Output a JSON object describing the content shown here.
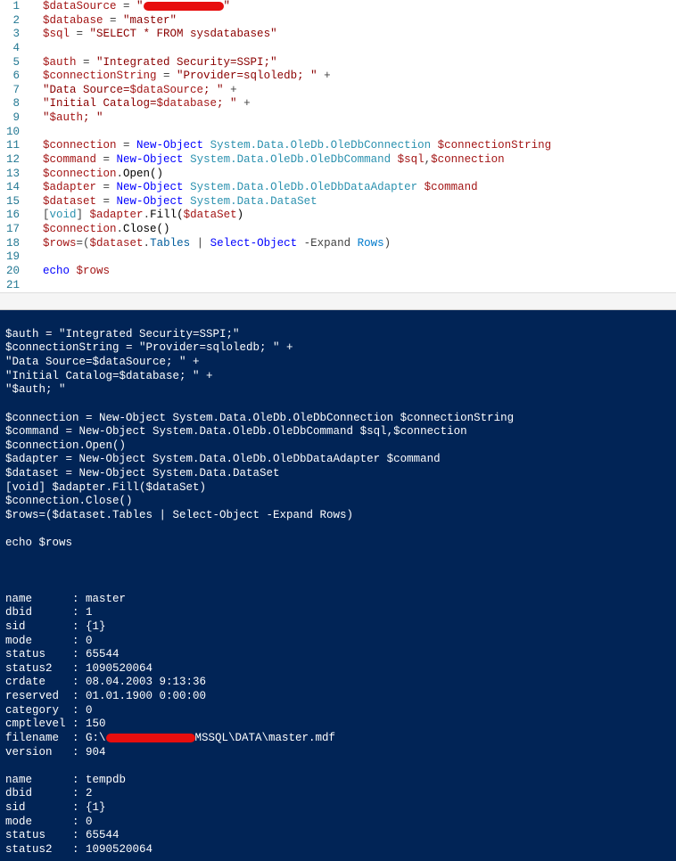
{
  "editor": {
    "lines": [
      {
        "n": 1,
        "tokens": [
          {
            "t": "$dataSource",
            "c": "tok-var"
          },
          {
            "t": " = ",
            "c": "tok-op"
          },
          {
            "t": "\"",
            "c": "tok-str"
          },
          {
            "redact": 90
          },
          {
            "t": "\"",
            "c": "tok-str"
          }
        ]
      },
      {
        "n": 2,
        "tokens": [
          {
            "t": "$database",
            "c": "tok-var"
          },
          {
            "t": " = ",
            "c": "tok-op"
          },
          {
            "t": "\"master\"",
            "c": "tok-str"
          }
        ]
      },
      {
        "n": 3,
        "tokens": [
          {
            "t": "$sql",
            "c": "tok-var"
          },
          {
            "t": " = ",
            "c": "tok-op"
          },
          {
            "t": "\"SELECT * FROM sysdatabases\"",
            "c": "tok-str"
          }
        ]
      },
      {
        "n": 4,
        "tokens": []
      },
      {
        "n": 5,
        "tokens": [
          {
            "t": "$auth",
            "c": "tok-var"
          },
          {
            "t": " = ",
            "c": "tok-op"
          },
          {
            "t": "\"Integrated Security=SSPI;\"",
            "c": "tok-str"
          }
        ]
      },
      {
        "n": 6,
        "tokens": [
          {
            "t": "$connectionString",
            "c": "tok-var"
          },
          {
            "t": " = ",
            "c": "tok-op"
          },
          {
            "t": "\"Provider=sqloledb; \"",
            "c": "tok-str"
          },
          {
            "t": " + ",
            "c": "tok-op"
          }
        ]
      },
      {
        "n": 7,
        "tokens": [
          {
            "t": "\"Data Source=",
            "c": "tok-str"
          },
          {
            "t": "$dataSource",
            "c": "tok-var"
          },
          {
            "t": "; \"",
            "c": "tok-str"
          },
          {
            "t": " + ",
            "c": "tok-op"
          }
        ]
      },
      {
        "n": 8,
        "tokens": [
          {
            "t": "\"Initial Catalog=",
            "c": "tok-str"
          },
          {
            "t": "$database",
            "c": "tok-var"
          },
          {
            "t": "; \"",
            "c": "tok-str"
          },
          {
            "t": " + ",
            "c": "tok-op"
          }
        ]
      },
      {
        "n": 9,
        "tokens": [
          {
            "t": "\"",
            "c": "tok-str"
          },
          {
            "t": "$auth",
            "c": "tok-var"
          },
          {
            "t": "; \"",
            "c": "tok-str"
          }
        ]
      },
      {
        "n": 10,
        "tokens": []
      },
      {
        "n": 11,
        "tokens": [
          {
            "t": "$connection",
            "c": "tok-var"
          },
          {
            "t": " = ",
            "c": "tok-op"
          },
          {
            "t": "New-Object",
            "c": "tok-kw"
          },
          {
            "t": " ",
            "c": ""
          },
          {
            "t": "System.Data.OleDb.OleDbConnection",
            "c": "tok-type"
          },
          {
            "t": " ",
            "c": ""
          },
          {
            "t": "$connectionString",
            "c": "tok-var"
          }
        ]
      },
      {
        "n": 12,
        "tokens": [
          {
            "t": "$command",
            "c": "tok-var"
          },
          {
            "t": " = ",
            "c": "tok-op"
          },
          {
            "t": "New-Object",
            "c": "tok-kw"
          },
          {
            "t": " ",
            "c": ""
          },
          {
            "t": "System.Data.OleDb.OleDbCommand",
            "c": "tok-type"
          },
          {
            "t": " ",
            "c": ""
          },
          {
            "t": "$sql",
            "c": "tok-var"
          },
          {
            "t": ",",
            "c": "tok-op"
          },
          {
            "t": "$connection",
            "c": "tok-var"
          }
        ]
      },
      {
        "n": 13,
        "tokens": [
          {
            "t": "$connection",
            "c": "tok-var"
          },
          {
            "t": ".",
            "c": "tok-op"
          },
          {
            "t": "Open()",
            "c": "tok-method"
          }
        ]
      },
      {
        "n": 14,
        "tokens": [
          {
            "t": "$adapter",
            "c": "tok-var"
          },
          {
            "t": " = ",
            "c": "tok-op"
          },
          {
            "t": "New-Object",
            "c": "tok-kw"
          },
          {
            "t": " ",
            "c": ""
          },
          {
            "t": "System.Data.OleDb.OleDbDataAdapter",
            "c": "tok-type"
          },
          {
            "t": " ",
            "c": ""
          },
          {
            "t": "$command",
            "c": "tok-var"
          }
        ]
      },
      {
        "n": 15,
        "tokens": [
          {
            "t": "$dataset",
            "c": "tok-var"
          },
          {
            "t": " = ",
            "c": "tok-op"
          },
          {
            "t": "New-Object",
            "c": "tok-kw"
          },
          {
            "t": " ",
            "c": ""
          },
          {
            "t": "System.Data.DataSet",
            "c": "tok-type"
          }
        ]
      },
      {
        "n": 16,
        "tokens": [
          {
            "t": "[",
            "c": "tok-op"
          },
          {
            "t": "void",
            "c": "tok-type"
          },
          {
            "t": "] ",
            "c": "tok-op"
          },
          {
            "t": "$adapter",
            "c": "tok-var"
          },
          {
            "t": ".",
            "c": "tok-op"
          },
          {
            "t": "Fill(",
            "c": "tok-method"
          },
          {
            "t": "$dataSet",
            "c": "tok-var"
          },
          {
            "t": ")",
            "c": "tok-method"
          }
        ]
      },
      {
        "n": 17,
        "tokens": [
          {
            "t": "$connection",
            "c": "tok-var"
          },
          {
            "t": ".",
            "c": "tok-op"
          },
          {
            "t": "Close()",
            "c": "tok-method"
          }
        ]
      },
      {
        "n": 18,
        "tokens": [
          {
            "t": "$rows",
            "c": "tok-var"
          },
          {
            "t": "=(",
            "c": "tok-op"
          },
          {
            "t": "$dataset",
            "c": "tok-var"
          },
          {
            "t": ".",
            "c": "tok-op"
          },
          {
            "t": "Tables",
            "c": "tok-tables"
          },
          {
            "t": " | ",
            "c": "tok-op"
          },
          {
            "t": "Select-Object",
            "c": "tok-kw"
          },
          {
            "t": " -Expand ",
            "c": "tok-op"
          },
          {
            "t": "Rows",
            "c": "tok-param"
          },
          {
            "t": ")",
            "c": "tok-op"
          }
        ]
      },
      {
        "n": 19,
        "tokens": []
      },
      {
        "n": 20,
        "tokens": [
          {
            "t": "echo",
            "c": "tok-kw"
          },
          {
            "t": " ",
            "c": ""
          },
          {
            "t": "$rows",
            "c": "tok-var"
          }
        ]
      },
      {
        "n": 21,
        "tokens": []
      }
    ]
  },
  "terminal": {
    "lines": [
      "",
      "$auth = \"Integrated Security=SSPI;\"",
      "$connectionString = \"Provider=sqloledb; \" +",
      "\"Data Source=$dataSource; \" +",
      "\"Initial Catalog=$database; \" +",
      "\"$auth; \"",
      "",
      "$connection = New-Object System.Data.OleDb.OleDbConnection $connectionString",
      "$command = New-Object System.Data.OleDb.OleDbCommand $sql,$connection",
      "$connection.Open()",
      "$adapter = New-Object System.Data.OleDb.OleDbDataAdapter $command",
      "$dataset = New-Object System.Data.DataSet",
      "[void] $adapter.Fill($dataSet)",
      "$connection.Close()",
      "$rows=($dataset.Tables | Select-Object -Expand Rows)",
      "",
      "echo $rows",
      "",
      "",
      "",
      "name      : master",
      "dbid      : 1",
      "sid       : {1}",
      "mode      : 0",
      "status    : 65544",
      "status2   : 1090520064",
      "crdate    : 08.04.2003 9:13:36",
      "reserved  : 01.01.1900 0:00:00",
      "category  : 0",
      "cmptlevel : 150",
      {
        "prefix": "filename  : G:\\",
        "redact": 100,
        "suffix": "MSSQL\\DATA\\master.mdf"
      },
      "version   : 904",
      "",
      "name      : tempdb",
      "dbid      : 2",
      "sid       : {1}",
      "mode      : 0",
      "status    : 65544",
      "status2   : 1090520064"
    ]
  }
}
